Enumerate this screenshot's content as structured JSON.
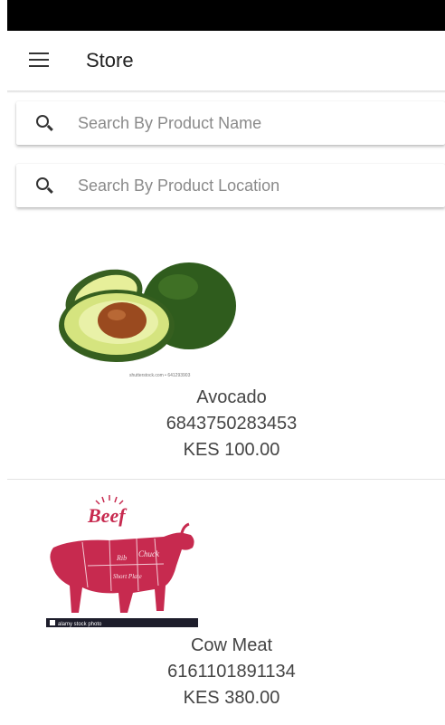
{
  "app_bar": {
    "title": "Store",
    "menu_icon": "menu-icon"
  },
  "search": {
    "product_name_placeholder": "Search By Product Name",
    "product_location_placeholder": "Search By Product Location"
  },
  "products": [
    {
      "name": "Avocado",
      "code": "6843750283453",
      "price": "KES 100.00",
      "image_caption": "shutterstock.com • 641293903"
    },
    {
      "name": "Cow Meat",
      "code": "6161101891134",
      "price": "KES 380.00",
      "image_title": "Beef",
      "image_labels": [
        "Chuck",
        "Rib",
        "Short Plate"
      ],
      "image_watermark": "alamy stock photo"
    }
  ],
  "colors": {
    "status_bar": "#000000",
    "beef_red": "#c72a4f",
    "avocado_skin": "#2e5a1f",
    "avocado_flesh": "#d8e58a",
    "avocado_pit": "#9a4a1f"
  }
}
